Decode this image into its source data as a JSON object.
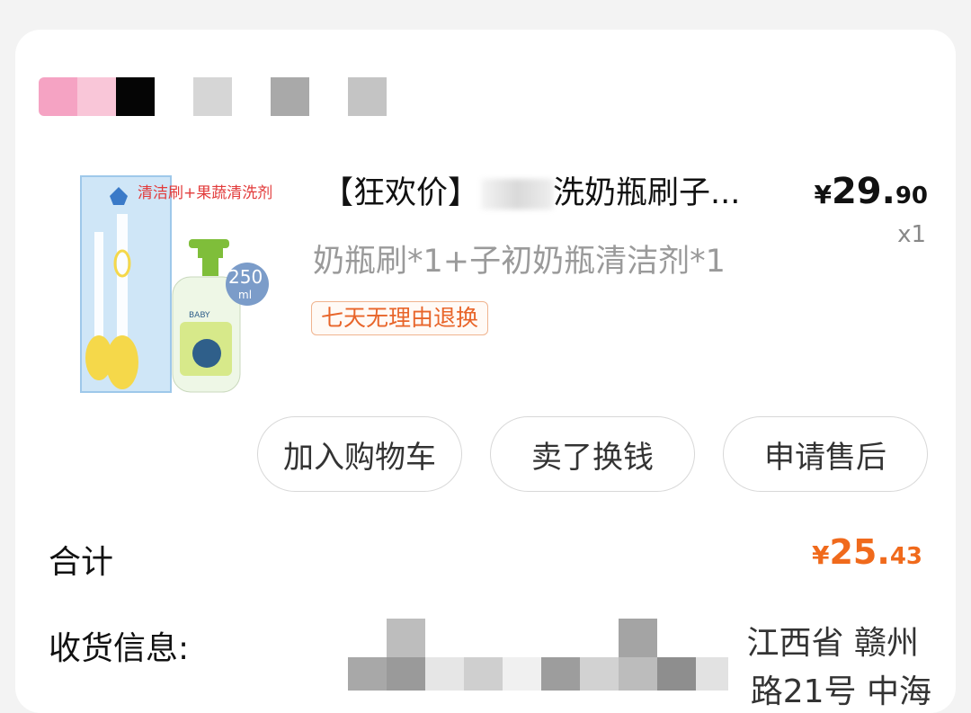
{
  "product": {
    "title_prefix": "【狂欢价】",
    "title_rest": "洗奶瓶刷子...",
    "price_currency": "¥",
    "price_int": "29.",
    "price_dec": "90",
    "quantity": "x1",
    "spec": "奶瓶刷*1+子初奶瓶清洁剂*1",
    "badge": "七天无理由退换",
    "image": {
      "banner": "清洁刷+果蔬清洗剂",
      "volume": "250",
      "volume_unit": "ml",
      "bottle_label": "BABY"
    }
  },
  "actions": {
    "add_to_cart": "加入购物车",
    "resell": "卖了换钱",
    "after_sales": "申请售后"
  },
  "summary": {
    "total_label": "合计",
    "total_currency": "¥",
    "total_int": "25.",
    "total_dec": "43"
  },
  "shipping": {
    "label": "收货信息:",
    "address_line1": "江西省 赣州",
    "address_line2": "路21号 中海"
  },
  "colors": {
    "accent": "#f06a1c",
    "badge_border": "#f0b48f"
  }
}
